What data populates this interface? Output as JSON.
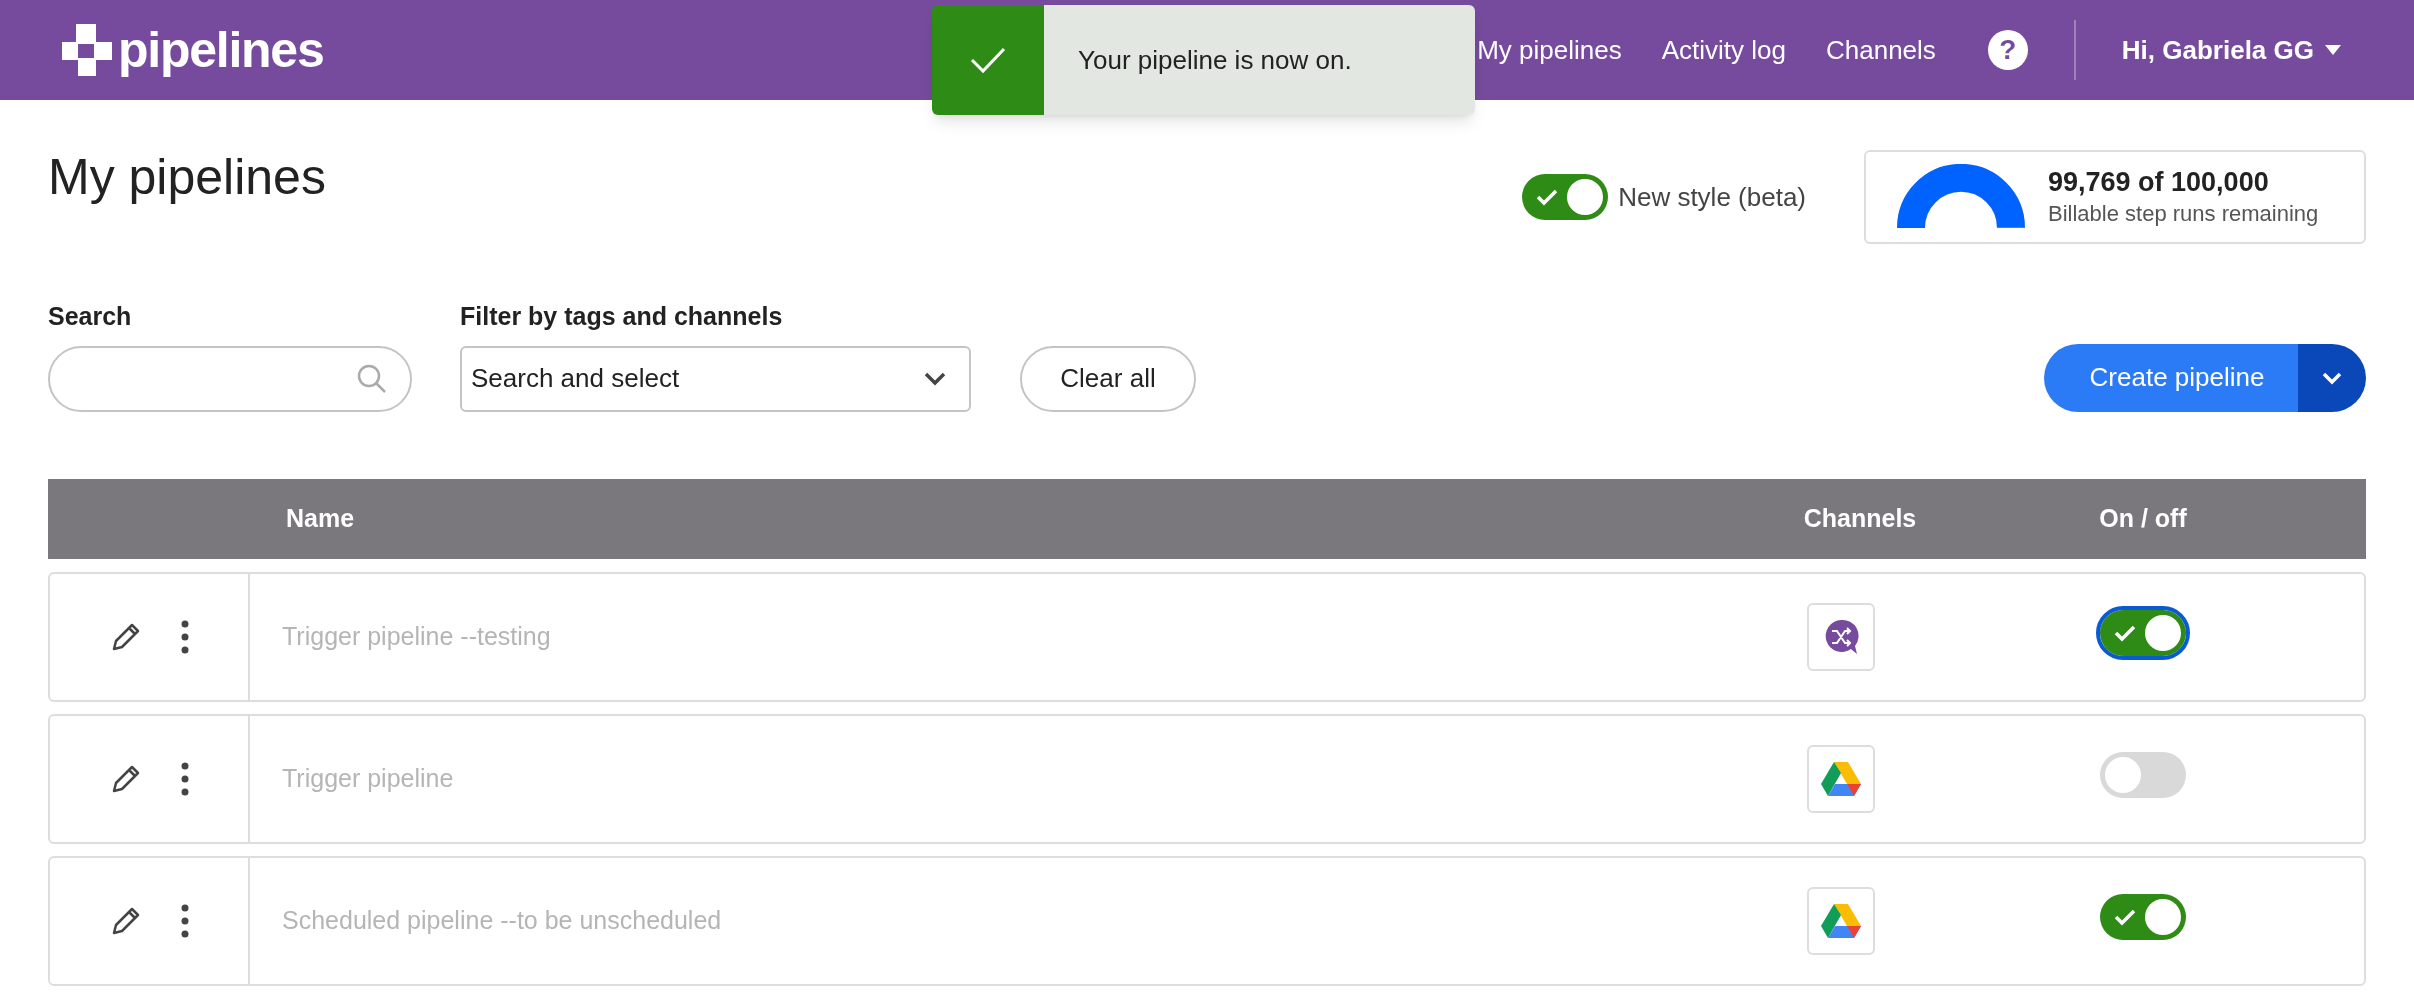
{
  "header": {
    "logo": "pipelines",
    "nav": [
      {
        "label": "My pipelines"
      },
      {
        "label": "Activity log"
      },
      {
        "label": "Channels"
      }
    ],
    "help": "?",
    "user": {
      "greeting": "Hi,",
      "name": "Gabriela GG"
    }
  },
  "toast": {
    "message": "Your pipeline is now on."
  },
  "page_title": "My pipelines",
  "new_style": {
    "label": "New style (beta)",
    "on": true
  },
  "usage": {
    "level": 0.998,
    "reading": "99,769 of 100,000",
    "caption": "Billable step runs remaining"
  },
  "search": {
    "label": "Search"
  },
  "filter": {
    "label": "Filter by tags and channels",
    "placeholder": "Search and select"
  },
  "clear_button": "Clear all",
  "create_button": "Create pipeline",
  "table": {
    "columns": [
      "Name",
      "Channels",
      "On / off"
    ],
    "rows": [
      {
        "name": "Trigger pipeline --testing",
        "channel": {
          "kind": "webhook"
        },
        "on": true,
        "focused": true
      },
      {
        "name": "Trigger pipeline",
        "channel": {
          "kind": "drive"
        },
        "on": false,
        "focused": false
      },
      {
        "name": "Scheduled pipeline --to be unscheduled",
        "channel": {
          "kind": "drive"
        },
        "on": true,
        "focused": false
      }
    ]
  }
}
